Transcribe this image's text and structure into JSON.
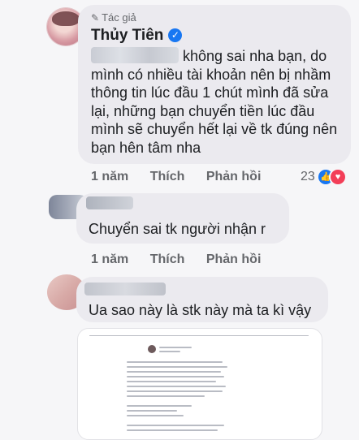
{
  "comment_main": {
    "author_badge": "Tác giả",
    "author_name": "Thủy Tiên",
    "text_line1": "không sai nha bạn, do",
    "text_rest": "mình có nhiều tài khoản nên bị nhầm thông tin lúc đầu 1 chút mình đã sửa lại, những bạn chuyển tiền lúc đầu mình sẽ chuyển hết lại về tk đúng nên bạn hên tâm nha",
    "time": "1 năm",
    "like_label": "Thích",
    "reply_label": "Phản hồi",
    "reaction_count": "23"
  },
  "reply_1": {
    "text": "Chuyển sai tk người nhận r",
    "time": "1 năm",
    "like_label": "Thích",
    "reply_label": "Phản hồi"
  },
  "reply_2": {
    "text": "Ua sao này là stk này mà ta kì vậy"
  },
  "colors": {
    "bubble": "#ebeaef",
    "secondary_text": "#65676b",
    "verified": "#1877f2",
    "like": "#1877f2",
    "love": "#f33e58"
  }
}
